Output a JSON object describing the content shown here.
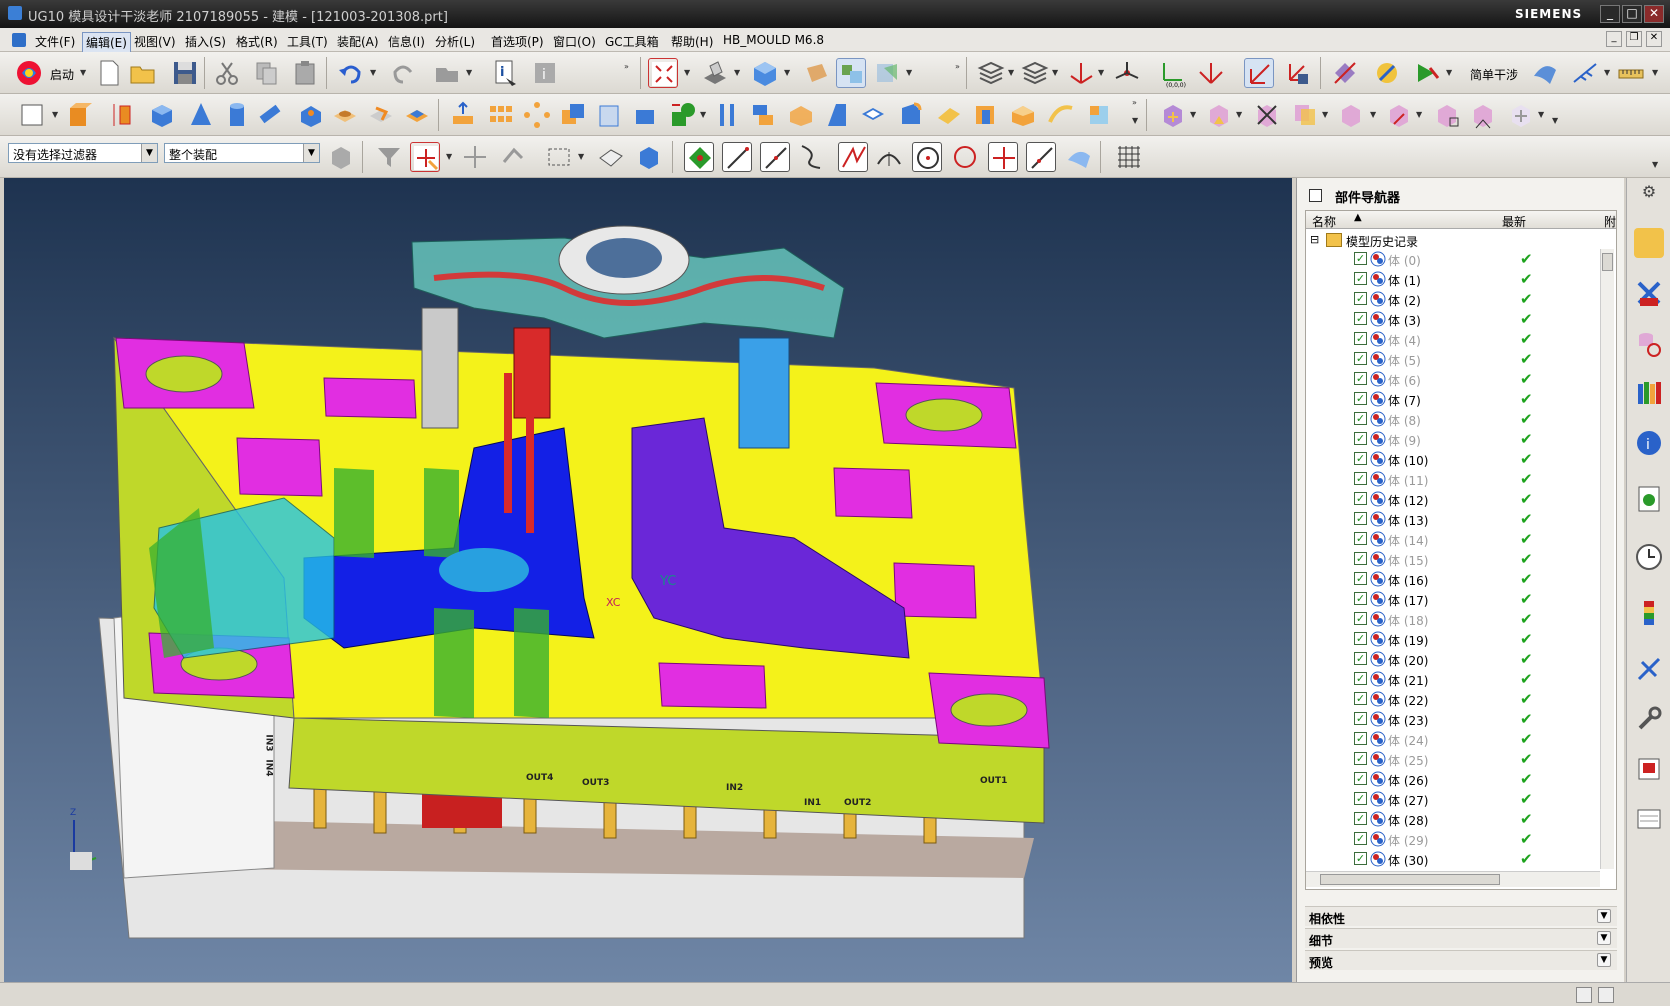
{
  "window": {
    "title": "UG10 模具设计干淡老师 2107189055 - 建模 - [121003-201308.prt]",
    "brand": "SIEMENS",
    "buttons": [
      "_",
      "□",
      "✕"
    ]
  },
  "menubar": {
    "items": [
      "文件(F)",
      "编辑(E)",
      "视图(V)",
      "插入(S)",
      "格式(R)",
      "工具(T)",
      "装配(A)",
      "信息(I)",
      "分析(L)",
      "首选项(P)",
      "窗口(O)",
      "GC工具箱",
      "帮助(H)",
      "HB_MOULD M6.8"
    ],
    "active_index": 1
  },
  "toolbar1": {
    "start_label": "启动",
    "simple_label": "简单干涉"
  },
  "selection_bar": {
    "filter_value": "没有选择过滤器",
    "scope_value": "整个装配"
  },
  "viewport": {
    "axis_labels": [
      "YC",
      "XC"
    ],
    "triad_label": "Z",
    "connector_labels": [
      "IN3",
      "IN4",
      "OUT4",
      "OUT3",
      "IN2",
      "IN1",
      "OUT2",
      "OUT1"
    ]
  },
  "navigator": {
    "title": "部件导航器",
    "col_name": "名称",
    "col_latest": "最新",
    "col_extra": "附",
    "root_label": "模型历史记录",
    "rows": [
      {
        "label": "体 (0)",
        "dim": true
      },
      {
        "label": "体 (1)",
        "dim": false
      },
      {
        "label": "体 (2)",
        "dim": false
      },
      {
        "label": "体 (3)",
        "dim": false
      },
      {
        "label": "体 (4)",
        "dim": true
      },
      {
        "label": "体 (5)",
        "dim": true
      },
      {
        "label": "体 (6)",
        "dim": true
      },
      {
        "label": "体 (7)",
        "dim": false
      },
      {
        "label": "体 (8)",
        "dim": true
      },
      {
        "label": "体 (9)",
        "dim": true
      },
      {
        "label": "体 (10)",
        "dim": false
      },
      {
        "label": "体 (11)",
        "dim": true
      },
      {
        "label": "体 (12)",
        "dim": false
      },
      {
        "label": "体 (13)",
        "dim": false
      },
      {
        "label": "体 (14)",
        "dim": true
      },
      {
        "label": "体 (15)",
        "dim": true
      },
      {
        "label": "体 (16)",
        "dim": false
      },
      {
        "label": "体 (17)",
        "dim": false
      },
      {
        "label": "体 (18)",
        "dim": true
      },
      {
        "label": "体 (19)",
        "dim": false
      },
      {
        "label": "体 (20)",
        "dim": false
      },
      {
        "label": "体 (21)",
        "dim": false
      },
      {
        "label": "体 (22)",
        "dim": false
      },
      {
        "label": "体 (23)",
        "dim": false
      },
      {
        "label": "体 (24)",
        "dim": true
      },
      {
        "label": "体 (25)",
        "dim": true
      },
      {
        "label": "体 (26)",
        "dim": false
      },
      {
        "label": "体 (27)",
        "dim": false
      },
      {
        "label": "体 (28)",
        "dim": false
      },
      {
        "label": "体 (29)",
        "dim": true
      },
      {
        "label": "体 (30)",
        "dim": false
      }
    ],
    "sections": [
      "相依性",
      "细节",
      "预览"
    ]
  }
}
